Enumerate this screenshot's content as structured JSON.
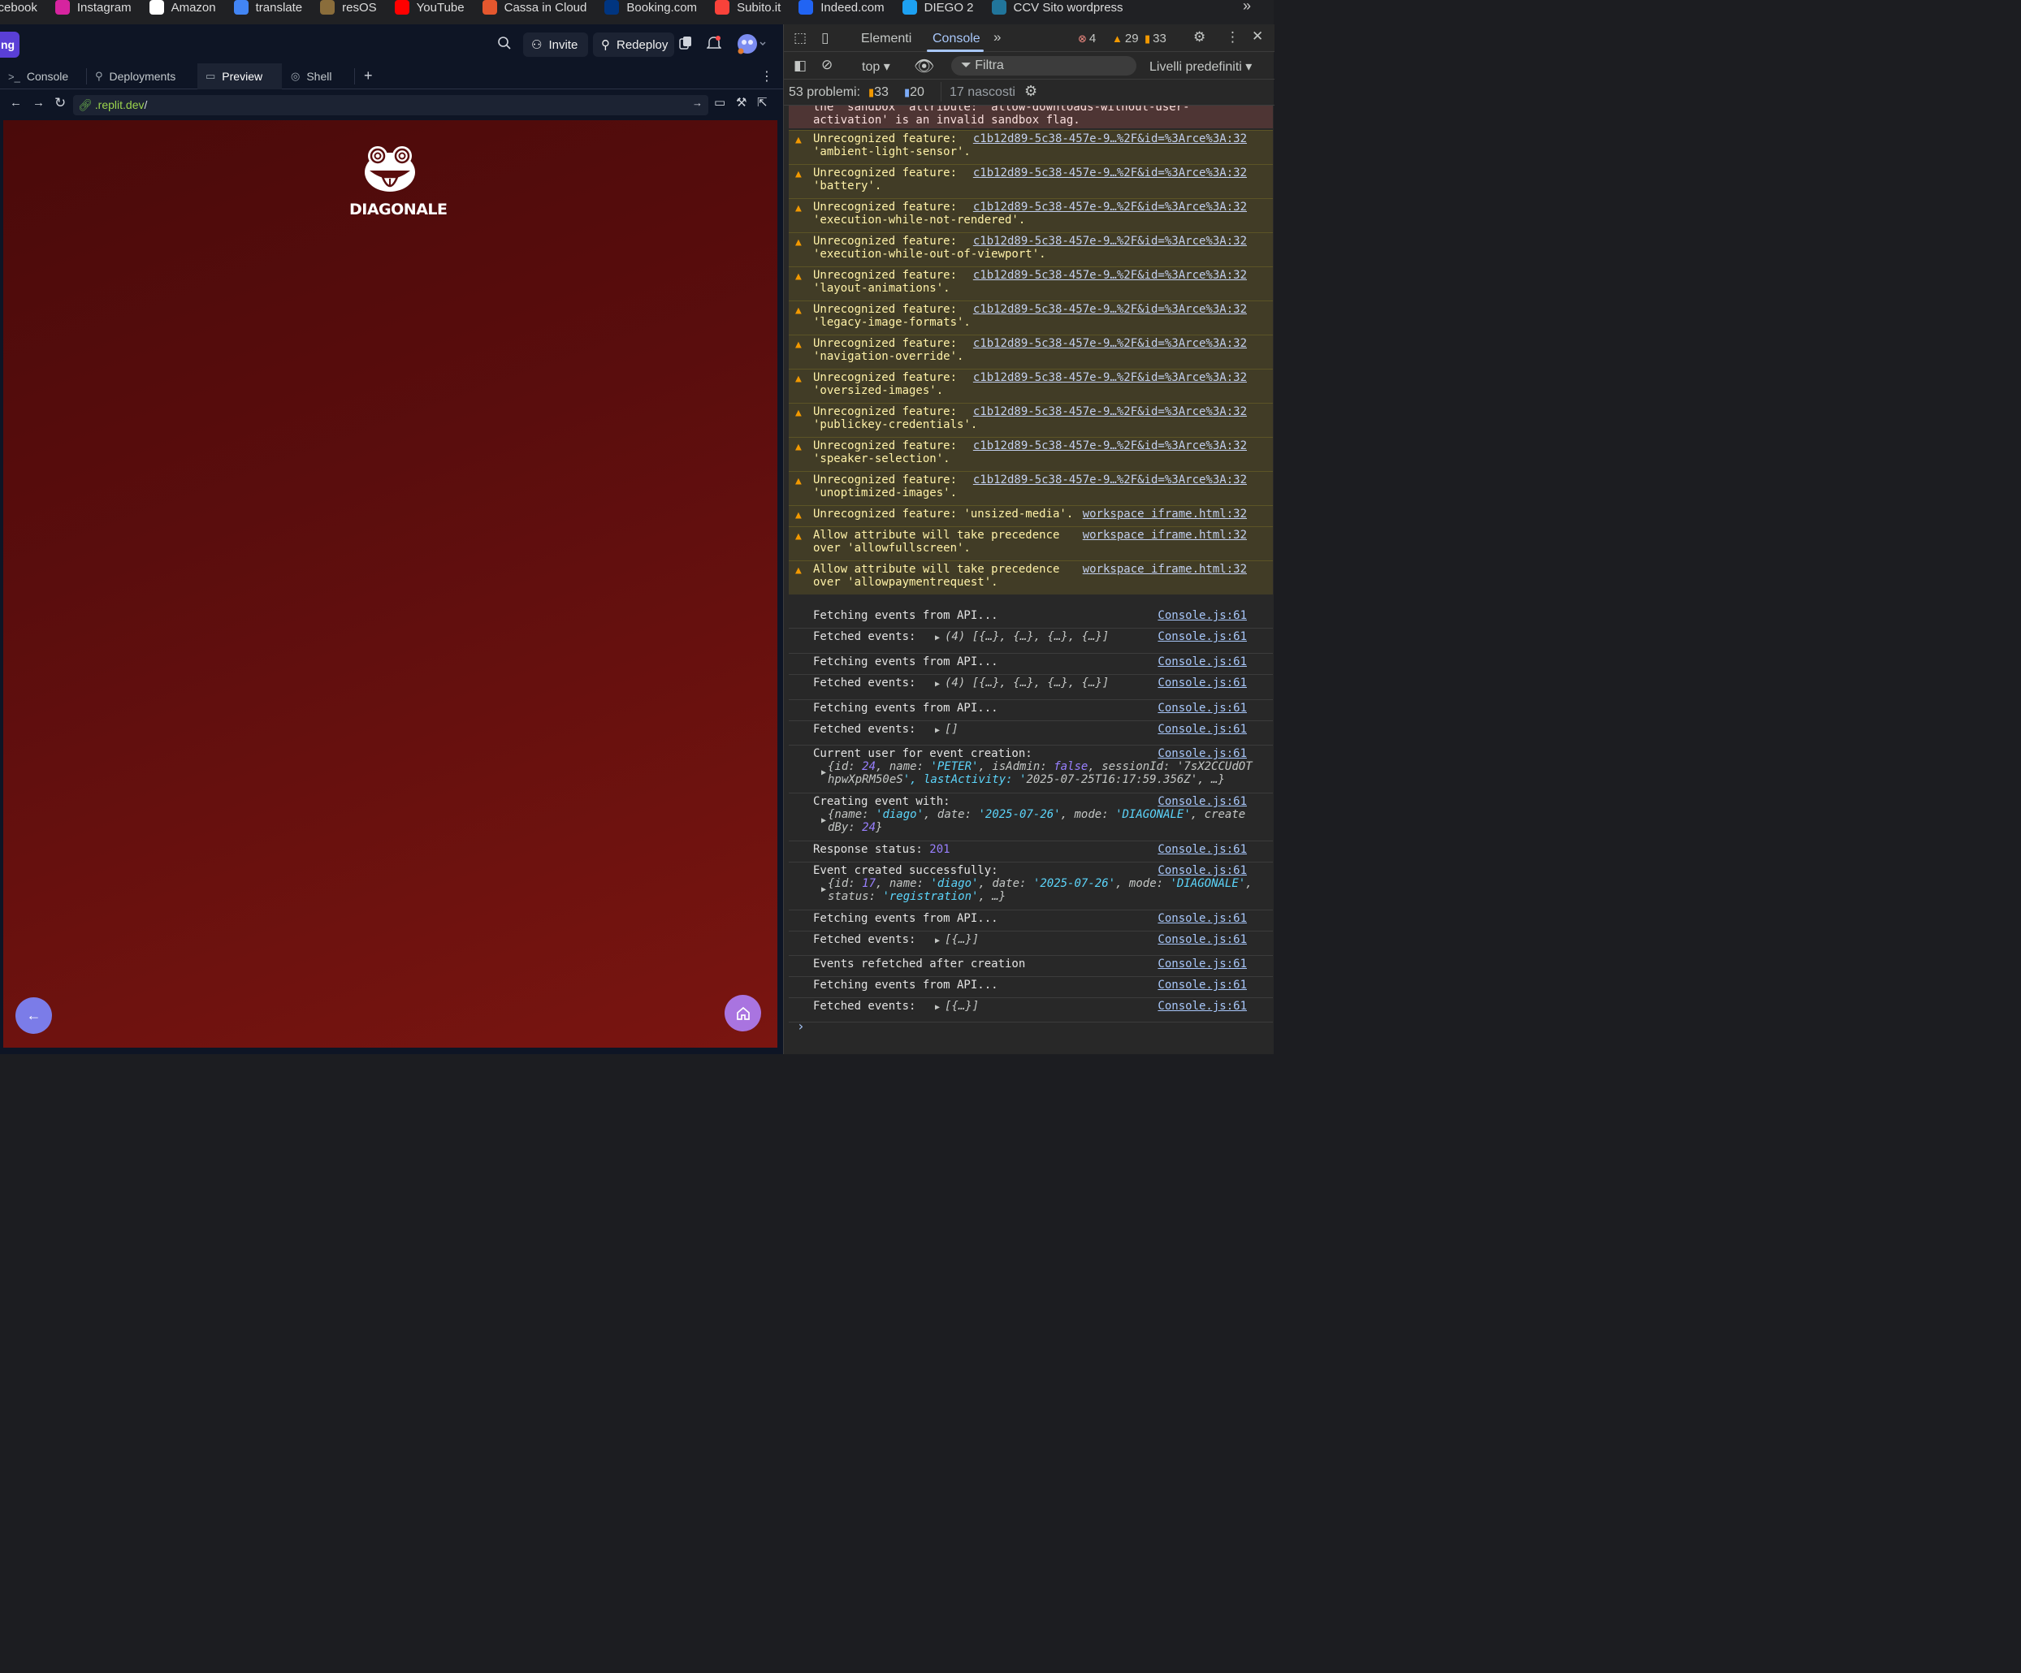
{
  "bookmarks": {
    "items": [
      {
        "label": "Facebook",
        "icon": "facebook-icon",
        "color": "#1877f2"
      },
      {
        "label": "Instagram",
        "icon": "instagram-icon",
        "color": "#d6249f"
      },
      {
        "label": "Amazon",
        "icon": "amazon-icon",
        "color": "#ffffff"
      },
      {
        "label": "translate",
        "icon": "translate-icon",
        "color": "#4285f4"
      },
      {
        "label": "resOS",
        "icon": "resos-icon",
        "color": "#8a6d3b"
      },
      {
        "label": "YouTube",
        "icon": "youtube-icon",
        "color": "#ff0000"
      },
      {
        "label": "Cassa in Cloud",
        "icon": "cassa-icon",
        "color": "#e4572e"
      },
      {
        "label": "Booking.com",
        "icon": "booking-icon",
        "color": "#003580"
      },
      {
        "label": "Subito.it",
        "icon": "subito-icon",
        "color": "#f9423a"
      },
      {
        "label": "Indeed.com",
        "icon": "indeed-icon",
        "color": "#2164f3"
      },
      {
        "label": "DIEGO 2",
        "icon": "diego-icon",
        "color": "#1da1f2"
      },
      {
        "label": "CCV Sito wordpress",
        "icon": "wordpress-icon",
        "color": "#21759b"
      }
    ],
    "more": "»"
  },
  "replit": {
    "tab_fragment": "ng",
    "invite_label": "Invite",
    "redeploy_label": "Redeploy",
    "tabs": [
      {
        "label": "Console",
        "glyph": ">_"
      },
      {
        "label": "Deployments",
        "glyph": "⚲"
      },
      {
        "label": "Preview",
        "glyph": "▭"
      },
      {
        "label": "Shell",
        "glyph": "◎"
      }
    ],
    "add_tab": "+",
    "url_host": ".replit.dev",
    "url_path": "/",
    "logo_text": "DIAGONALE",
    "accent": "#5a3fd6"
  },
  "devtools": {
    "tabs": {
      "elements": "Elementi",
      "console": "Console"
    },
    "counts": {
      "errors": "4",
      "warnings": "29",
      "issues": "33"
    },
    "context": "top",
    "filter_placeholder": "Filtra",
    "levels": "Livelli predefiniti",
    "problems": {
      "label": "53 problemi:",
      "warn": "33",
      "info": "20",
      "hidden": "17 nascosti"
    },
    "error_text": "the 'sandbox' attribute: 'allow-downloads-without-user-\nactivation' is an invalid sandbox flag.",
    "warnings": [
      {
        "l1": "Unrecognized feature:",
        "l2": "'ambient-light-sensor'.",
        "src": "c1b12d89-5c38-457e-9…%2F&id=%3Arce%3A:32"
      },
      {
        "l1": "Unrecognized feature:",
        "l2": "'battery'.",
        "src": "c1b12d89-5c38-457e-9…%2F&id=%3Arce%3A:32"
      },
      {
        "l1": "Unrecognized feature:",
        "l2": "'execution-while-not-rendered'.",
        "src": "c1b12d89-5c38-457e-9…%2F&id=%3Arce%3A:32"
      },
      {
        "l1": "Unrecognized feature:",
        "l2": "'execution-while-out-of-viewport'.",
        "src": "c1b12d89-5c38-457e-9…%2F&id=%3Arce%3A:32"
      },
      {
        "l1": "Unrecognized feature:",
        "l2": "'layout-animations'.",
        "src": "c1b12d89-5c38-457e-9…%2F&id=%3Arce%3A:32"
      },
      {
        "l1": "Unrecognized feature:",
        "l2": "'legacy-image-formats'.",
        "src": "c1b12d89-5c38-457e-9…%2F&id=%3Arce%3A:32"
      },
      {
        "l1": "Unrecognized feature:",
        "l2": "'navigation-override'.",
        "src": "c1b12d89-5c38-457e-9…%2F&id=%3Arce%3A:32"
      },
      {
        "l1": "Unrecognized feature:",
        "l2": "'oversized-images'.",
        "src": "c1b12d89-5c38-457e-9…%2F&id=%3Arce%3A:32"
      },
      {
        "l1": "Unrecognized feature:",
        "l2": "'publickey-credentials'.",
        "src": "c1b12d89-5c38-457e-9…%2F&id=%3Arce%3A:32"
      },
      {
        "l1": "Unrecognized feature:",
        "l2": "'speaker-selection'.",
        "src": "c1b12d89-5c38-457e-9…%2F&id=%3Arce%3A:32"
      },
      {
        "l1": "Unrecognized feature:",
        "l2": "'unoptimized-images'.",
        "src": "c1b12d89-5c38-457e-9…%2F&id=%3Arce%3A:32"
      },
      {
        "l1": "Unrecognized feature: 'unsized-media'.",
        "l2": "",
        "src": "workspace iframe.html:32"
      },
      {
        "l1": "Allow attribute will take precedence",
        "l2": "over 'allowfullscreen'.",
        "src": "workspace iframe.html:32"
      },
      {
        "l1": "Allow attribute will take precedence",
        "l2": "over 'allowpaymentrequest'.",
        "src": "workspace iframe.html:32"
      }
    ],
    "logs": {
      "fetching": "Fetching events from API...",
      "fetched": "Fetched events:",
      "fetched4": "(4) [{…}, {…}, {…}, {…}]",
      "fetched0": "[]",
      "fetched1": "[{…}]",
      "current_user": "Current user for event creation:",
      "user_obj_1": "{id: 24, name: 'PETER', isAdmin: false, sessionId: '7sX2CCUdOT",
      "user_obj_2": "hpwXpRM50eS', lastActivity: '2025-07-25T16:17:59.356Z', …}",
      "creating": "Creating event with:",
      "create_obj_1": "{name: 'diago', date: '2025-07-26', mode: 'DIAGONALE', create",
      "create_obj_2": "dBy: 24}",
      "response_label": "Response status:",
      "response_value": "201",
      "created": "Event created successfully:",
      "created_obj_1": "{id: 17, name: 'diago', date: '2025-07-26', mode: 'DIAGONALE',",
      "created_obj_2": "status: 'registration', …}",
      "refetched": "Events refetched after creation",
      "src": "Console.js:61"
    },
    "prompt": "›"
  }
}
